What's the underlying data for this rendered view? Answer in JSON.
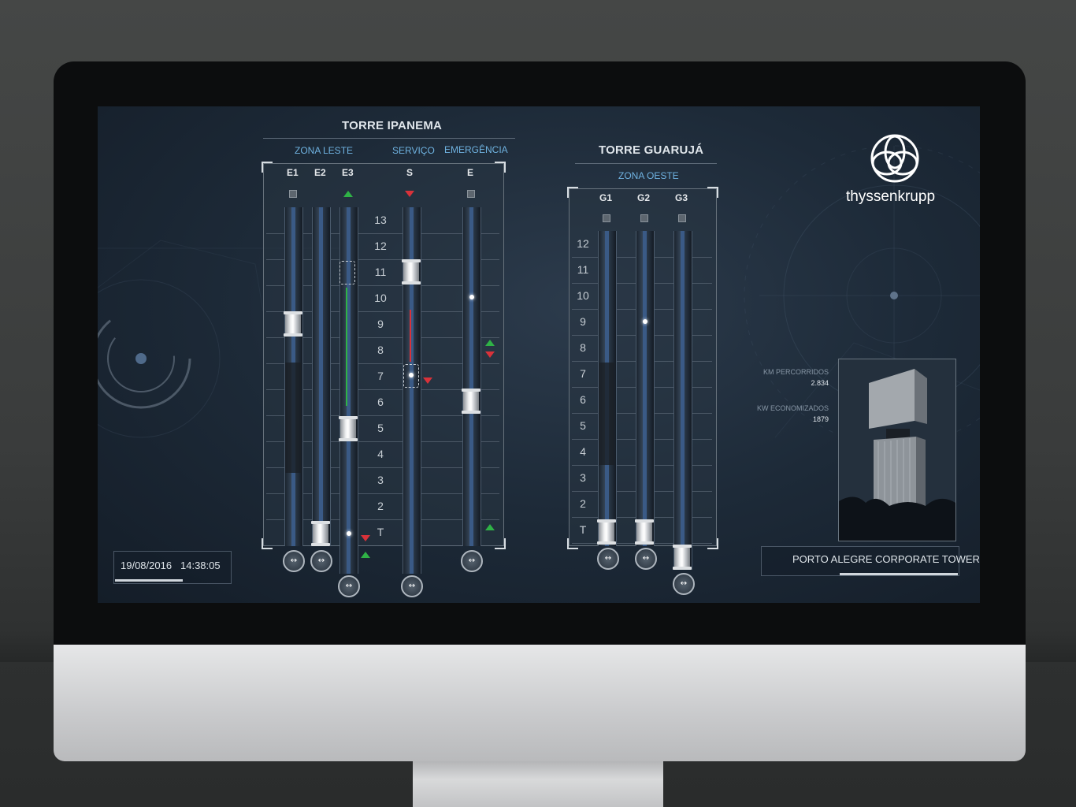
{
  "left_tower": {
    "title": "TORRE IPANEMA",
    "zones": [
      "ZONA LESTE",
      "SERVIÇO",
      "EMERGÊNCIA"
    ],
    "columns": [
      "E1",
      "E2",
      "E3",
      "S",
      "E"
    ],
    "floors": [
      "13",
      "12",
      "11",
      "10",
      "9",
      "8",
      "7",
      "6",
      "5",
      "4",
      "3",
      "2",
      "T"
    ]
  },
  "right_tower": {
    "title": "TORRE GUARUJÁ",
    "zone": "ZONA OESTE",
    "columns": [
      "G1",
      "G2",
      "G3"
    ],
    "floors": [
      "12",
      "11",
      "10",
      "9",
      "8",
      "7",
      "6",
      "5",
      "4",
      "3",
      "2",
      "T"
    ]
  },
  "status": {
    "date": "19/08/2016",
    "time": "14:38:05"
  },
  "brand": {
    "logo_text": "thyssenkrupp"
  },
  "stats": [
    {
      "label": "KM PERCORRIDOS",
      "value": "2.834"
    },
    {
      "label": "KW ECONOMIZADOS",
      "value": "1879"
    }
  ],
  "project_name": "PORTO ALEGRE CORPORATE TOWERS",
  "controls": {
    "shaft_button_symbol": "↔"
  },
  "colors": {
    "accent_blue": "#6fb2e0",
    "up_green": "#2fb246",
    "down_red": "#d8323a",
    "screen_bg": "#1d2a38"
  },
  "icons": [
    "tk-logo-icon",
    "arrow-up-icon",
    "arrow-down-icon",
    "door-button-icon"
  ]
}
